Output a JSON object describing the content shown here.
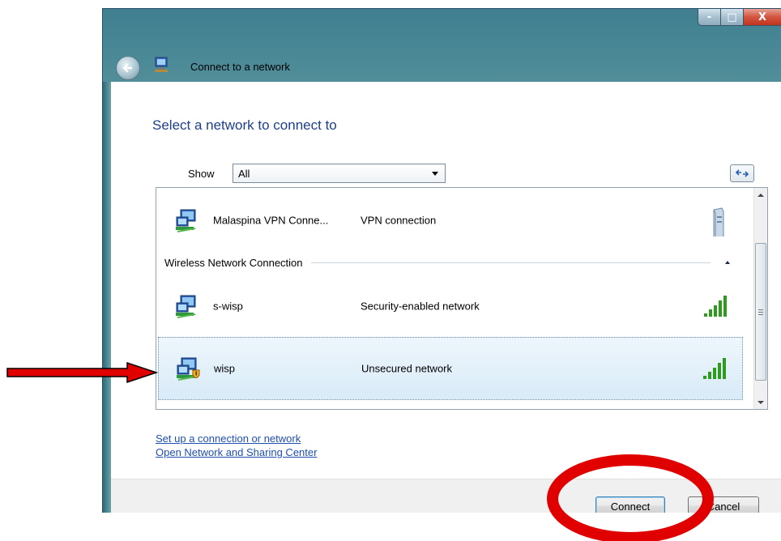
{
  "window": {
    "title": "Connect to a network",
    "controls": {
      "minimize": "-",
      "maximize": "□",
      "close": "X"
    }
  },
  "heading": "Select a network to connect to",
  "filter": {
    "label": "Show",
    "value": "All"
  },
  "networks": {
    "vpn": {
      "name": "Malaspina VPN Conne...",
      "type": "VPN connection"
    },
    "group": {
      "label": "Wireless Network Connection"
    },
    "wireless": [
      {
        "name": "s-wisp",
        "type": "Security-enabled network",
        "signal_bars": 5
      },
      {
        "name": "wisp",
        "type": "Unsecured network",
        "signal_bars": 5,
        "selected": true
      }
    ]
  },
  "links": {
    "setup": "Set up a connection or network",
    "center": "Open Network and Sharing Center"
  },
  "buttons": {
    "connect": "Connect",
    "cancel": "Cancel"
  },
  "colors": {
    "heading": "#1e3f8a",
    "link": "#1f4fb0",
    "signal": "#2e9a1e",
    "annotation": "#e00000"
  },
  "icons": {
    "back": "back-arrow-icon",
    "refresh": "refresh-icon",
    "network": "network-computer-icon",
    "vpn_server": "server-icon",
    "signal": "signal-strength-icon",
    "warning": "warning-shield-icon"
  }
}
